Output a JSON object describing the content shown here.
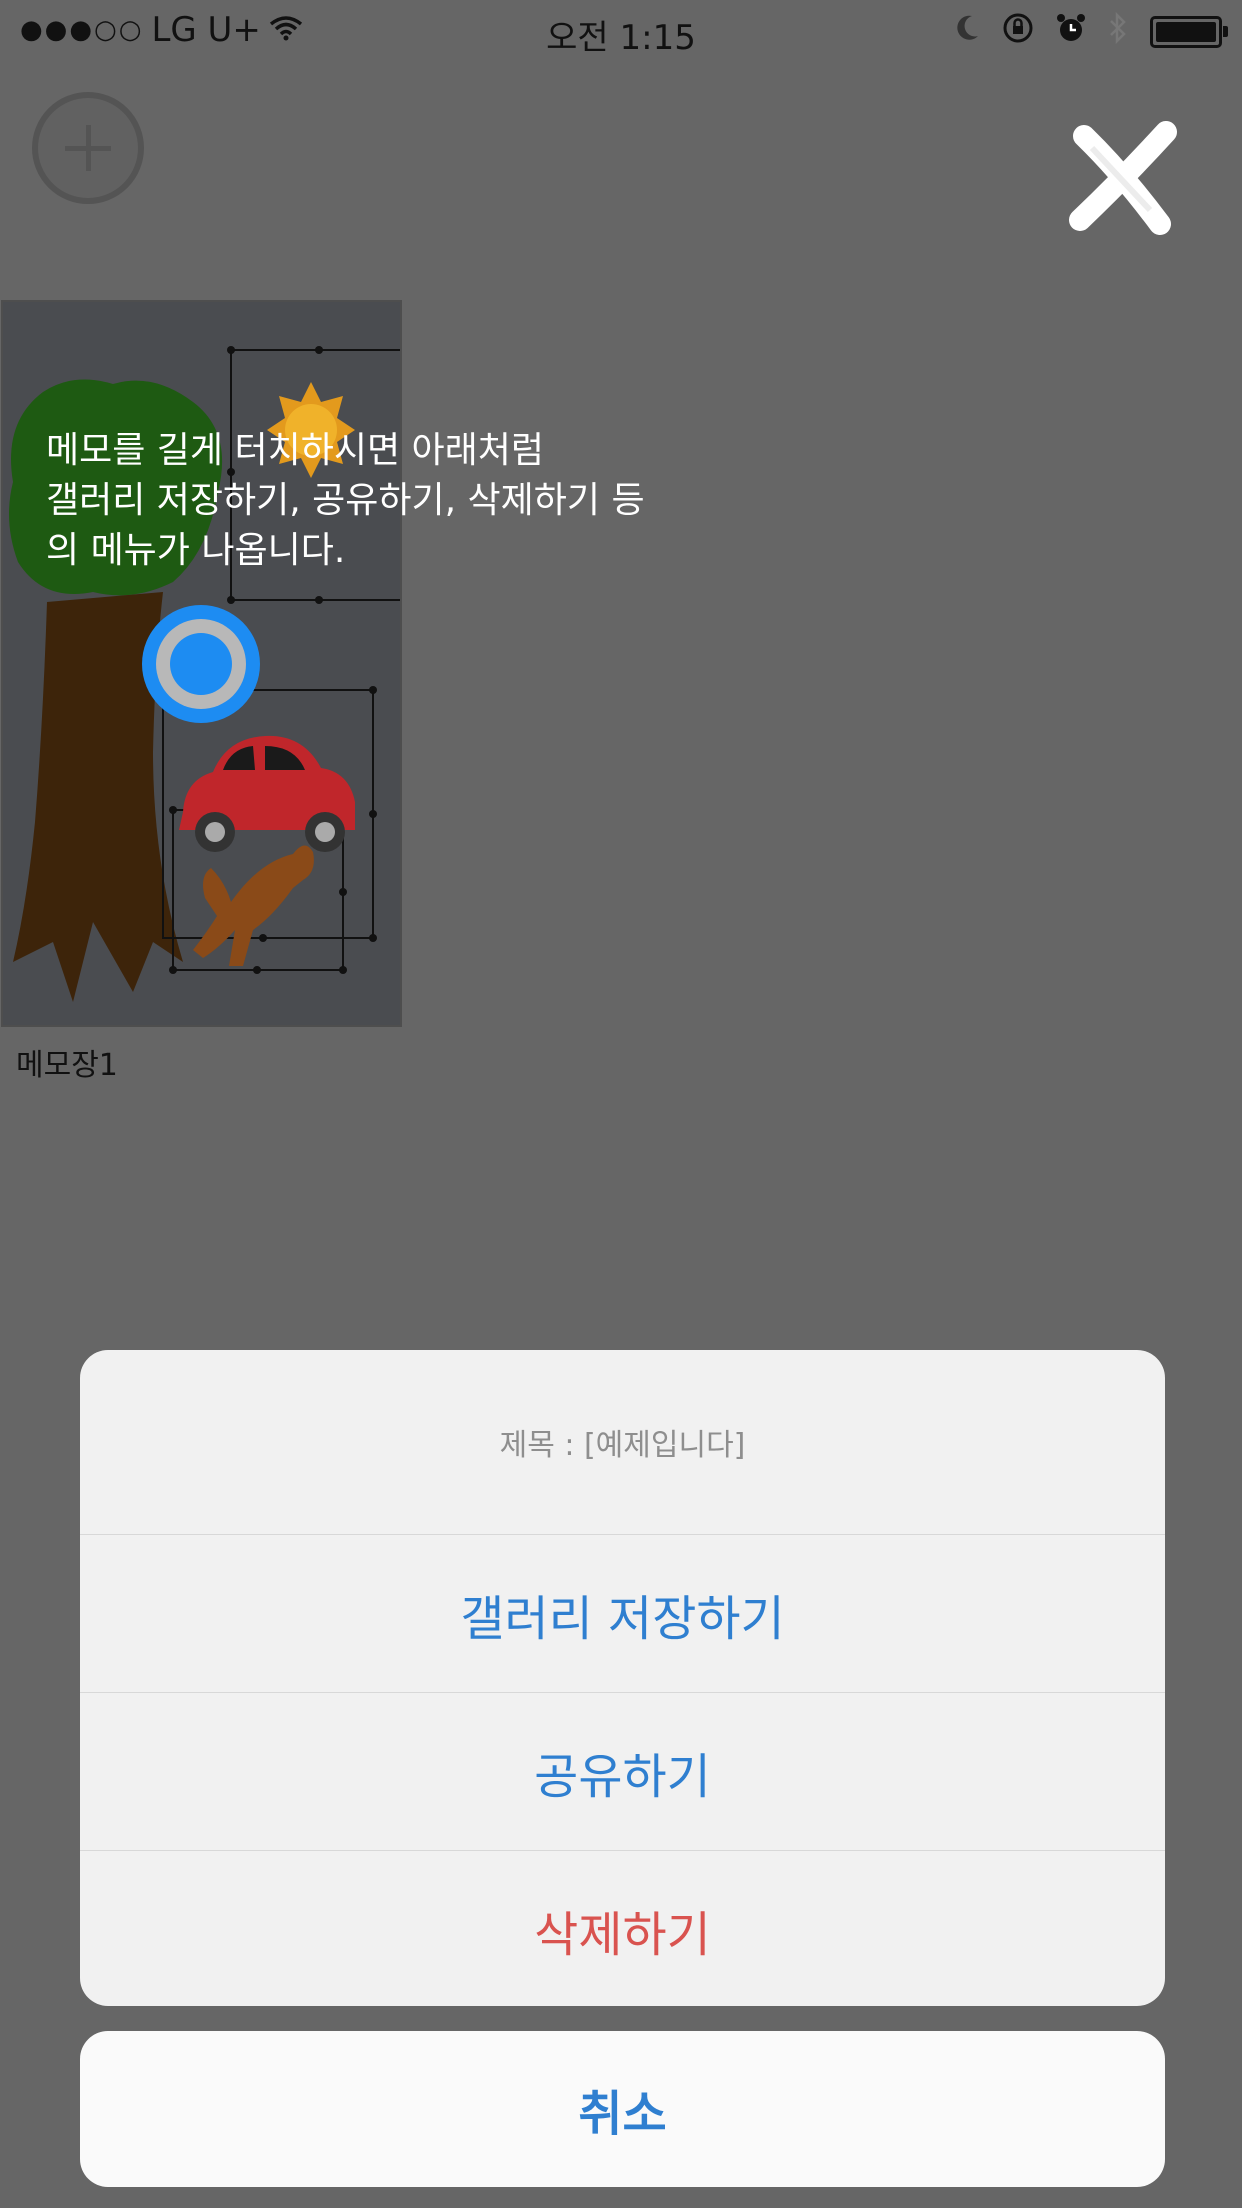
{
  "status_bar": {
    "signal_dots": "●●●○○",
    "carrier": "LG U+",
    "time": "오전 1:15",
    "icons": [
      "wifi-icon",
      "moon-icon",
      "rotation-lock-icon",
      "alarm-icon",
      "bluetooth-icon",
      "battery-icon"
    ]
  },
  "toolbar": {
    "add_icon": "plus-circle-icon",
    "close_icon": "close-x-icon"
  },
  "memo": {
    "name": "메모장1",
    "hint_text": "메모를 길게 터치하시면 아래처럼\n갤러리 저장하기, 공유하기, 삭제하기 등\n의 메뉴가 나옵니다."
  },
  "action_sheet": {
    "title": "제목 : [예제입니다]",
    "items": [
      {
        "label": "갤러리 저장하기",
        "color": "#2f7fd0"
      },
      {
        "label": "공유하기",
        "color": "#2f7fd0"
      },
      {
        "label": "삭제하기",
        "color": "#d9534f"
      }
    ],
    "cancel_label": "취소"
  },
  "colors": {
    "overlay": "#666666",
    "accent": "#2f7fd0",
    "destructive": "#d9534f",
    "touch_indicator": "#1d8cf2"
  }
}
